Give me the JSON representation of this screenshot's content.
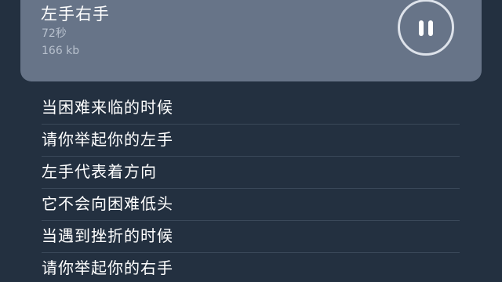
{
  "player": {
    "title": "左手右手",
    "duration": "72秒",
    "size": "166 kb",
    "state": "playing",
    "pause_icon": "pause-icon",
    "colors": {
      "background": "#233040",
      "card": "#677488",
      "text": "#ffffff",
      "meta": "#b7c0cd"
    }
  },
  "lyrics": [
    "当困难来临的时候",
    "请你举起你的左手",
    "左手代表着方向",
    "它不会向困难低头",
    "当遇到挫折的时候",
    "请你举起你的右手"
  ]
}
